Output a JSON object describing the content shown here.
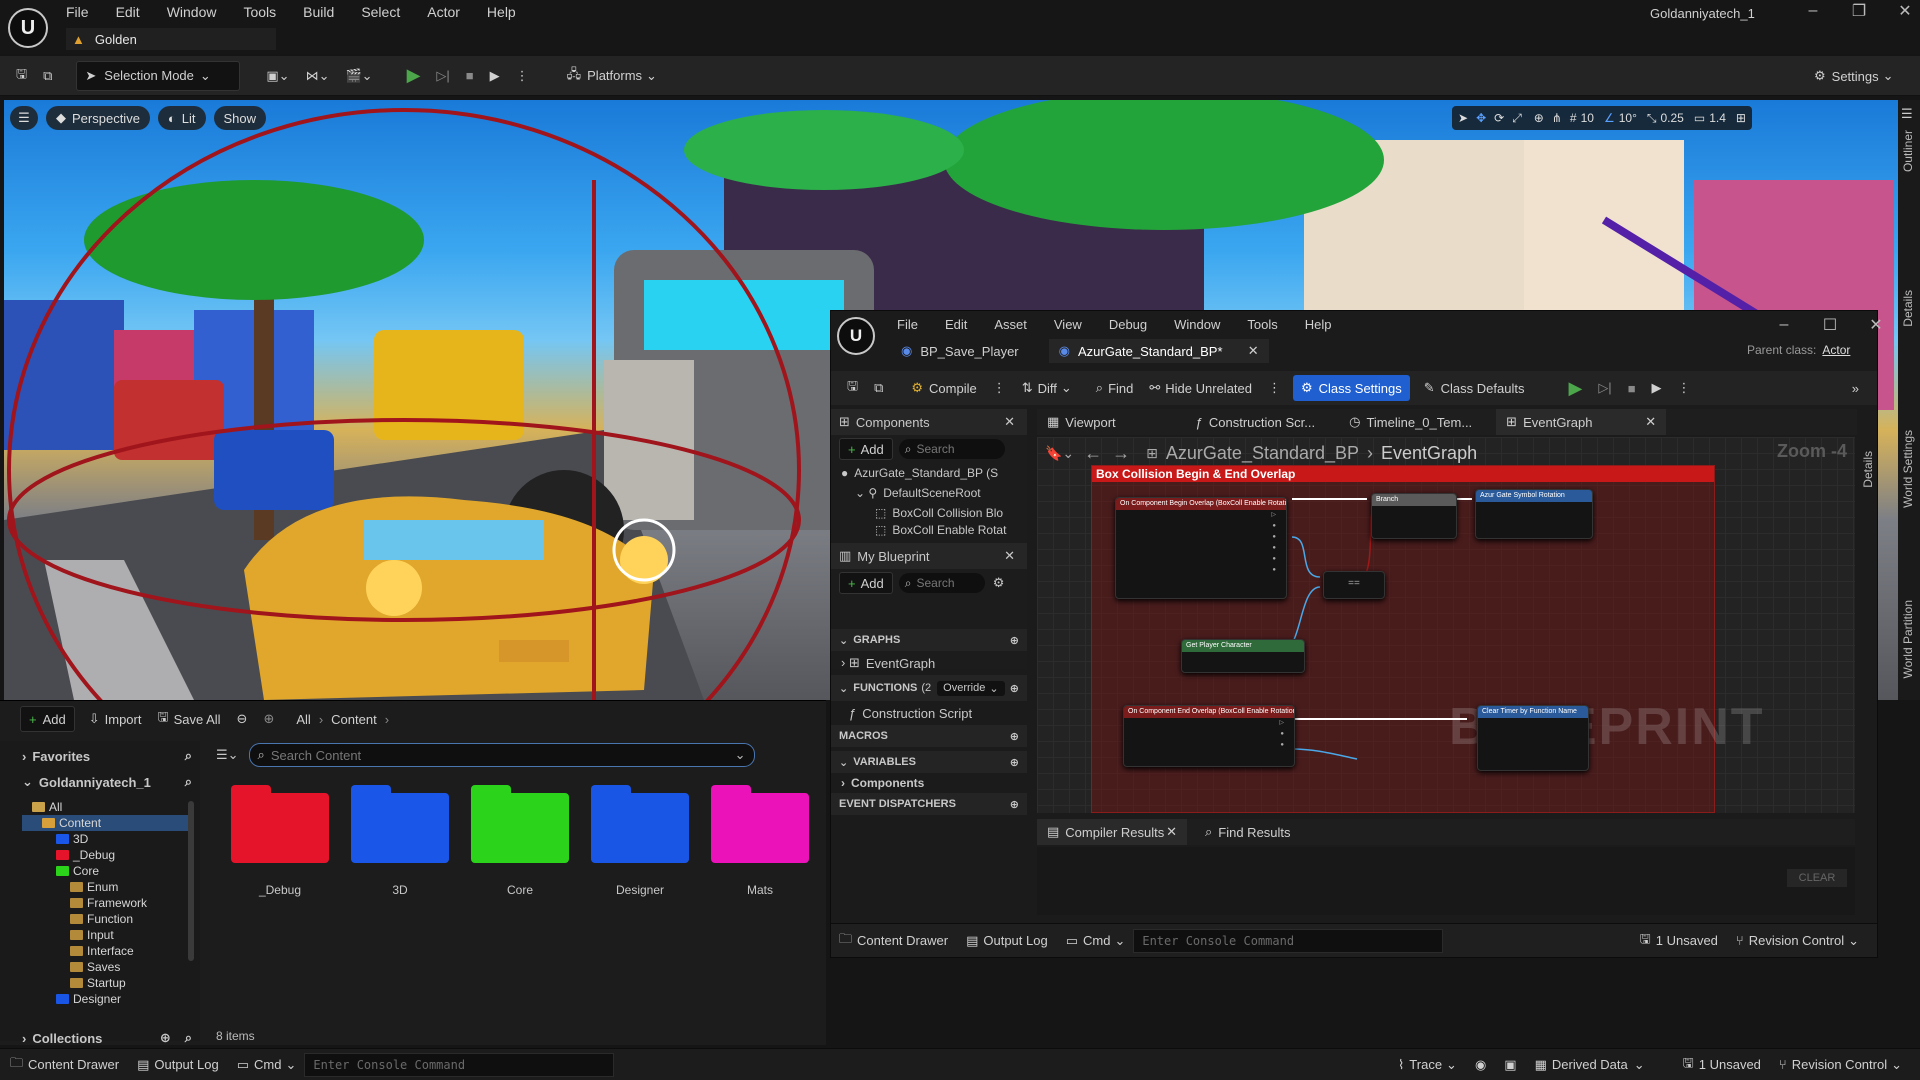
{
  "app": {
    "logo": "U",
    "menu": [
      "File",
      "Edit",
      "Window",
      "Tools",
      "Build",
      "Select",
      "Actor",
      "Help"
    ],
    "project_name": "Goldanniyatech_1",
    "level_tab": "Golden"
  },
  "toolbar": {
    "selection_mode": "Selection Mode",
    "platforms": "Platforms",
    "settings": "Settings"
  },
  "viewport": {
    "perspective": "Perspective",
    "lit": "Lit",
    "show": "Show",
    "grid_snap": "10",
    "rot_snap": "10°",
    "scale_snap": "0.25",
    "cam_speed": "1.4"
  },
  "content_browser": {
    "add": "Add",
    "import": "Import",
    "save_all": "Save All",
    "crumb_all": "All",
    "crumb_content": "Content",
    "favorites": "Favorites",
    "project": "Goldanniyatech_1",
    "search_placeholder": "Search Content",
    "tree": [
      "All",
      "Content",
      "3D",
      "_Debug",
      "Core",
      "Enum",
      "Framework",
      "Function",
      "Input",
      "Interface",
      "Saves",
      "Startup",
      "Designer"
    ],
    "collections": "Collections",
    "item_count": "8 items",
    "folders": [
      {
        "name": "_Debug",
        "color": "#e5142a"
      },
      {
        "name": "3D",
        "color": "#1a57e8"
      },
      {
        "name": "Core",
        "color": "#2bd41a"
      },
      {
        "name": "Designer",
        "color": "#1a56e6"
      },
      {
        "name": "Mats",
        "color": "#ea12b8"
      }
    ]
  },
  "blueprint": {
    "menu": [
      "File",
      "Edit",
      "Asset",
      "View",
      "Debug",
      "Window",
      "Tools",
      "Help"
    ],
    "tab1": "BP_Save_Player",
    "tab2": "AzurGate_Standard_BP*",
    "parent_class_label": "Parent class:",
    "parent_class": "Actor",
    "compile": "Compile",
    "diff": "Diff",
    "find": "Find",
    "hide_unrelated": "Hide Unrelated",
    "class_settings": "Class Settings",
    "class_defaults": "Class Defaults",
    "components_title": "Components",
    "add": "Add",
    "search": "Search",
    "components": [
      "AzurGate_Standard_BP (S",
      "DefaultSceneRoot",
      "BoxColl Collision Blo",
      "BoxColl Enable Rotat"
    ],
    "my_blueprint": "My Blueprint",
    "graphs": "GRAPHS",
    "event_graph_item": "EventGraph",
    "functions": "FUNCTIONS",
    "functions_count": "(2",
    "override": "Override",
    "construction_script": "Construction Script",
    "macros": "MACROS",
    "variables": "VARIABLES",
    "var_components": "Components",
    "event_dispatchers": "EVENT DISPATCHERS",
    "graph_tabs": [
      "Viewport",
      "Construction Scr...",
      "Timeline_0_Tem...",
      "EventGraph"
    ],
    "breadcrumb_bp": "AzurGate_Standard_BP",
    "breadcrumb_graph": "EventGraph",
    "zoom": "Zoom -4",
    "comment_title": "Box Collision Begin & End Overlap",
    "watermark": "BLUEPRINT",
    "node_begin": "On Component Begin Overlap (BoxColl Enable Rotation)",
    "node_end": "On Component End Overlap (BoxColl Enable Rotation)",
    "node_branch": "Branch",
    "node_rot": "Azur Gate Symbol Rotation",
    "node_player": "Get Player Character",
    "node_timer": "Clear Timer by Function Name",
    "compiler_results": "Compiler Results",
    "find_results": "Find Results",
    "clear": "CLEAR",
    "content_drawer": "Content Drawer",
    "output_log": "Output Log",
    "cmd": "Cmd",
    "console_placeholder": "Enter Console Command",
    "unsaved": "1 Unsaved",
    "revision_control": "Revision Control"
  },
  "statusbar": {
    "content_drawer": "Content Drawer",
    "output_log": "Output Log",
    "cmd": "Cmd",
    "console_placeholder": "Enter Console Command",
    "trace": "Trace",
    "derived_data": "Derived Data",
    "unsaved": "1 Unsaved",
    "revision_control": "Revision Control"
  },
  "side_tabs": [
    "Outliner",
    "Details",
    "World Settings",
    "World Partition",
    "Details"
  ]
}
